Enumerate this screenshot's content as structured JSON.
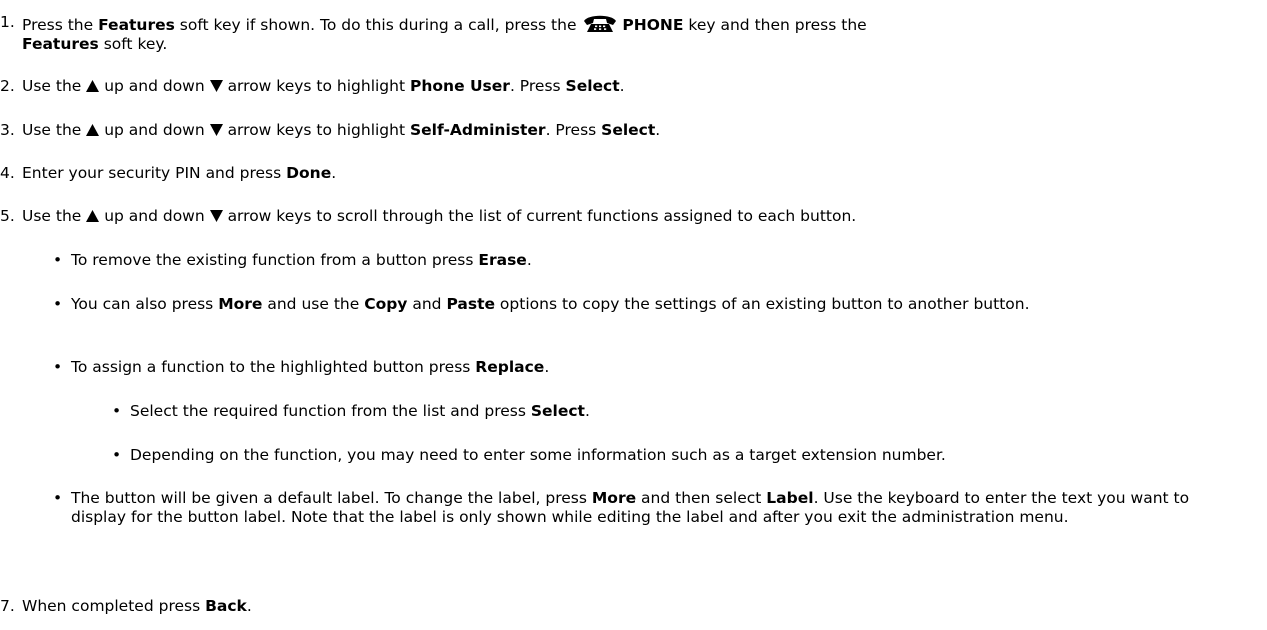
{
  "steps": [
    {
      "number": "1.",
      "text_parts": [
        "Press the ",
        "Features",
        " soft key if shown. To do this during a call, press the ",
        "PHONE",
        " key and then press the ",
        "Features",
        " soft key."
      ]
    },
    {
      "number": "2.",
      "text_parts": [
        "Use the ",
        "up and down ",
        "arrow keys to highlight ",
        "Phone User",
        ". Press ",
        "Select",
        "."
      ]
    },
    {
      "number": "3.",
      "text_parts": [
        "Use the ",
        "up and down ",
        "arrow keys to highlight ",
        "Self-Administer",
        ". Press ",
        "Select",
        "."
      ]
    },
    {
      "number": "4.",
      "text_parts": [
        "Enter your security PIN and press ",
        "Done",
        "."
      ]
    },
    {
      "number": "5.",
      "text_parts": [
        "Use the ",
        "up and down ",
        "arrow keys to scroll through the list of current functions assigned to each button."
      ]
    },
    {
      "number": "7.",
      "text_parts": [
        "When completed press ",
        "Back",
        "."
      ]
    }
  ],
  "bullets": [
    {
      "text_parts": [
        "To remove the existing function from a button press ",
        "Erase",
        "."
      ]
    },
    {
      "text_parts": [
        "You can also press ",
        "More",
        " and use the ",
        "Copy",
        " and ",
        "Paste",
        " options to copy the settings of an existing button to another button."
      ]
    },
    {
      "text_parts": [
        "To assign a function to the highlighted button press ",
        "Replace",
        "."
      ]
    },
    {
      "text_parts": [
        "The button will be given a default label. To change the label, press ",
        "More",
        " and then select ",
        "Label",
        ". Use the keyboard to enter the text you want to display for the button label. Note that the label is only shown while editing the label and after you exit the administration menu."
      ]
    }
  ],
  "sub_bullets": [
    {
      "text_parts": [
        "Select the required function from the list and press ",
        "Select",
        "."
      ]
    },
    {
      "text_parts": [
        "Depending on the function, you may need to enter some information such as a target extension number."
      ]
    }
  ],
  "bullet_char": "•",
  "icons": {
    "phone": "phone-icon",
    "up": "up-arrow-icon",
    "down": "down-arrow-icon"
  }
}
